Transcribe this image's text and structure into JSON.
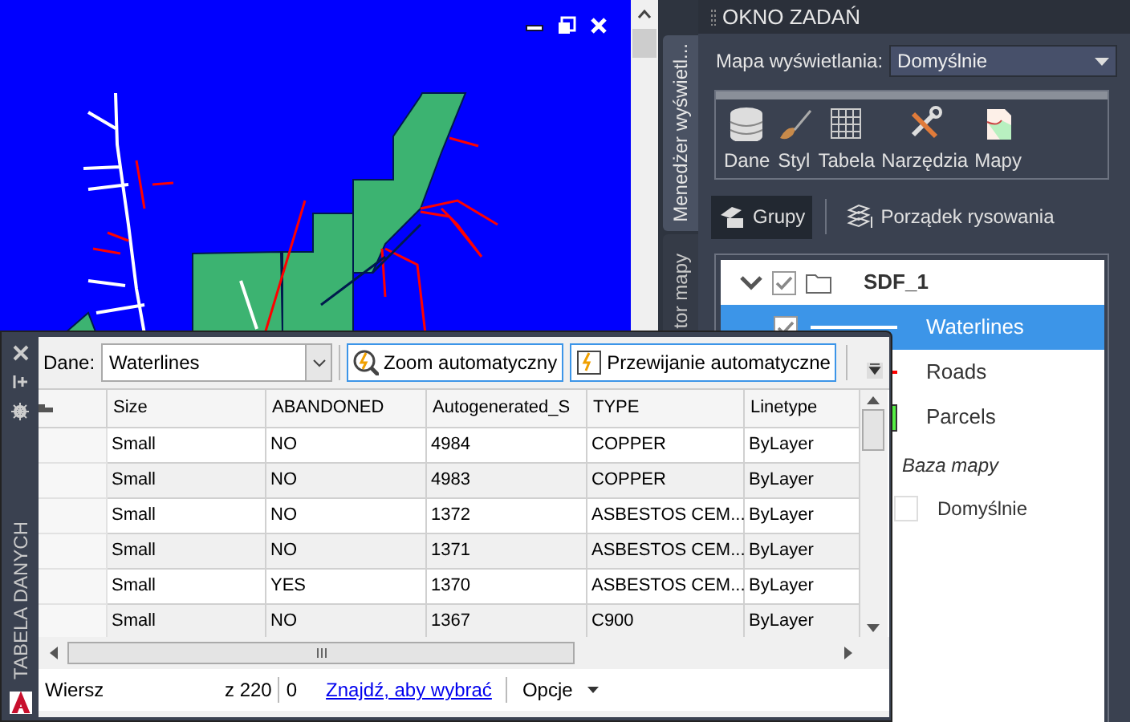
{
  "map_window": {
    "kind": "map"
  },
  "task_pane": {
    "title": "OKNO ZADAŃ",
    "side_tabs": [
      {
        "label": "Menedżer wyświetl...",
        "selected": true
      },
      {
        "label": "tor mapy",
        "selected": false
      }
    ],
    "display_map": {
      "label": "Mapa wyświetlania:",
      "value": "Domyślnie"
    },
    "tools": [
      {
        "kind": "data",
        "label": "Dane"
      },
      {
        "kind": "style",
        "label": "Styl"
      },
      {
        "kind": "table",
        "label": "Tabela"
      },
      {
        "kind": "tools",
        "label": "Narzędzia"
      },
      {
        "kind": "maps",
        "label": "Mapy"
      }
    ],
    "view_tabs": [
      {
        "kind": "groups",
        "label": "Grupy",
        "selected": true
      },
      {
        "kind": "order",
        "label": "Porządek rysowania",
        "selected": false
      }
    ],
    "layers": [
      {
        "label": "SDF_1",
        "checked": true,
        "expanded": true,
        "children": [
          {
            "label": "Waterlines",
            "checked": true,
            "selected": true,
            "kind": "line",
            "color": "#ffffff"
          },
          {
            "label": "Roads",
            "selected": false,
            "kind": "line",
            "color": "#ff0000"
          },
          {
            "label": "Parcels",
            "selected": false,
            "kind": "fill",
            "color": "#55ee44"
          }
        ]
      }
    ],
    "base_map": {
      "title": "Baza mapy",
      "items": [
        {
          "label": "Domyślnie"
        }
      ]
    }
  },
  "data_table": {
    "side_label": "TABELA DANYCH",
    "source_label": "Dane:",
    "source": "Waterlines",
    "buttons": [
      "Zoom automatyczny",
      "Przewijanie automatyczne"
    ],
    "columns": [
      "Size",
      "ABANDONED",
      "Autogenerated_S",
      "TYPE",
      "Linetype"
    ],
    "rows": [
      [
        "Small",
        "NO",
        "4984",
        "COPPER",
        "ByLayer"
      ],
      [
        "Small",
        "NO",
        "4983",
        "COPPER",
        "ByLayer"
      ],
      [
        "Small",
        "NO",
        "1372",
        "ASBESTOS CEM...",
        "ByLayer"
      ],
      [
        "Small",
        "NO",
        "1371",
        "ASBESTOS CEM...",
        "ByLayer"
      ],
      [
        "Small",
        "YES",
        "1370",
        "ASBESTOS CEM...",
        "ByLayer"
      ],
      [
        "Small",
        "NO",
        "1367",
        "C900",
        "ByLayer"
      ]
    ],
    "status": {
      "row_label": "Wiersz",
      "total": "z 220",
      "selected_count": "0",
      "find_link": "Znajdź, aby wybrać",
      "options": "Opcje"
    }
  }
}
